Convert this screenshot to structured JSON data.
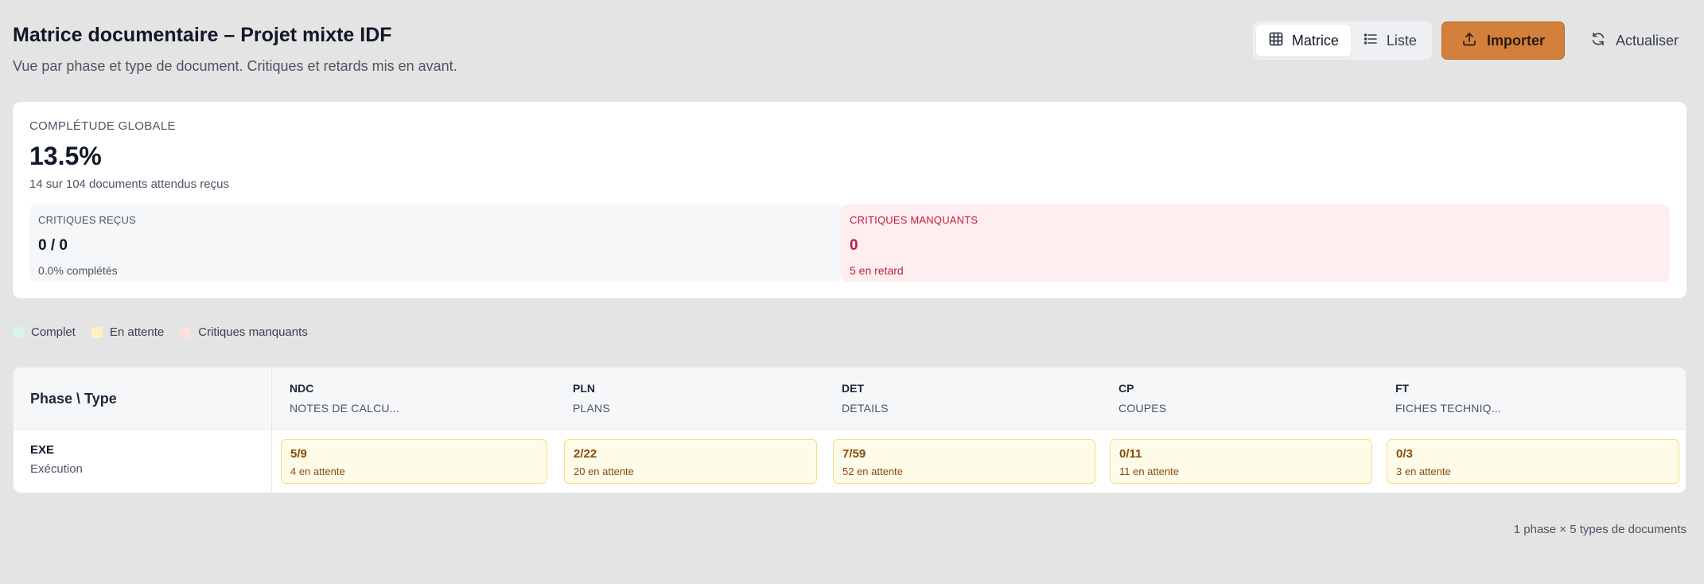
{
  "header": {
    "title": "Matrice documentaire – Projet mixte IDF",
    "subtitle": "Vue par phase et type de document. Critiques et retards mis en avant."
  },
  "toolbar": {
    "view_matrix_label": "Matrice",
    "view_list_label": "Liste",
    "active_view": "Matrice",
    "import_label": "Importer",
    "refresh_label": "Actualiser",
    "accent_color": "#d3803d"
  },
  "summary": {
    "label": "COMPLÉTUDE GLOBALE",
    "value": "13.5%",
    "sub": "14 sur 104 documents attendus reçus",
    "critical_received": {
      "label": "CRITIQUES REÇUS",
      "value": "0 / 0",
      "sub": "0.0% complétés"
    },
    "critical_missing": {
      "label": "CRITIQUES MANQUANTS",
      "value": "0",
      "sub": "5 en retard",
      "color": "#c01e3b"
    }
  },
  "legend": [
    {
      "label": "Complet",
      "color": "#d7f5e6"
    },
    {
      "label": "En attente",
      "color": "#fdf1c2"
    },
    {
      "label": "Critiques manquants",
      "color": "#fde0e0"
    }
  ],
  "matrix": {
    "corner_label": "Phase \\ Type",
    "columns": [
      {
        "code": "NDC",
        "name": "NOTES DE CALCU..."
      },
      {
        "code": "PLN",
        "name": "PLANS"
      },
      {
        "code": "DET",
        "name": "DETAILS"
      },
      {
        "code": "CP",
        "name": "COUPES"
      },
      {
        "code": "FT",
        "name": "FICHES TECHNIQ..."
      }
    ],
    "rows": [
      {
        "code": "EXE",
        "name": "Exécution",
        "cells": [
          {
            "count": "5/9",
            "pending": "4 en attente"
          },
          {
            "count": "2/22",
            "pending": "20 en attente"
          },
          {
            "count": "7/59",
            "pending": "52 en attente"
          },
          {
            "count": "0/11",
            "pending": "11 en attente"
          },
          {
            "count": "0/3",
            "pending": "3 en attente"
          }
        ]
      }
    ]
  },
  "footer": {
    "note": "1 phase × 5 types de documents"
  }
}
